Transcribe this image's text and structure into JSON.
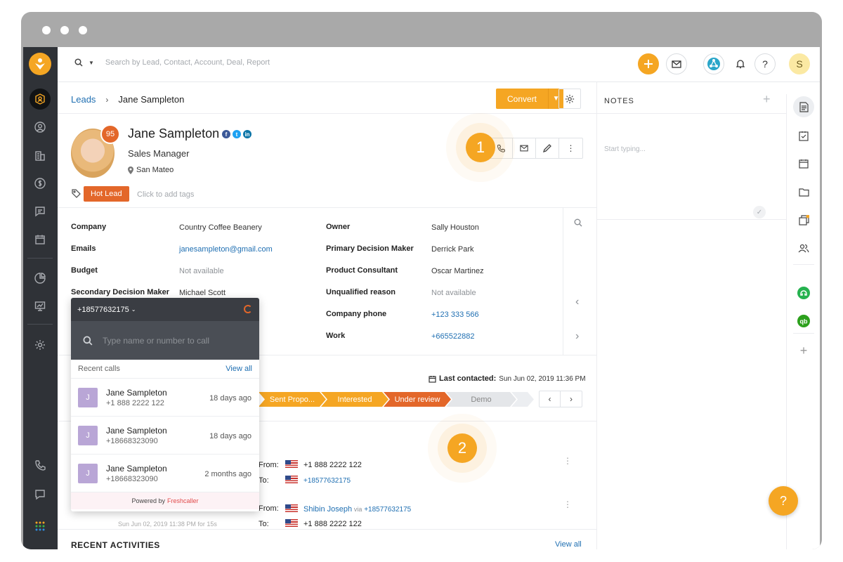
{
  "search": {
    "placeholder": "Search by Lead, Contact, Account, Deal, Report"
  },
  "topbar": {
    "avatar_initial": "S"
  },
  "breadcrumb": {
    "root": "Leads",
    "current": "Jane Sampleton"
  },
  "actions": {
    "convert_label": "Convert"
  },
  "lead": {
    "name": "Jane Sampleton",
    "score": "95",
    "title": "Sales Manager",
    "location": "San Mateo",
    "tag": "Hot Lead",
    "add_tags_placeholder": "Click to add tags"
  },
  "tour": {
    "step1": "1",
    "step2": "2"
  },
  "fields_left": [
    {
      "label": "Company",
      "value": "Country Coffee Beanery"
    },
    {
      "label": "Emails",
      "value": "janesampleton@gmail.com"
    },
    {
      "label": "Budget",
      "value": "Not available"
    },
    {
      "label": "Secondary Decision Maker",
      "value": "Michael Scott"
    }
  ],
  "fields_right": [
    {
      "label": "Owner",
      "value": "Sally Houston"
    },
    {
      "label": "Primary Decision Maker",
      "value": "Derrick Park"
    },
    {
      "label": "Product Consultant",
      "value": "Oscar Martinez"
    },
    {
      "label": "Unqualified reason",
      "value": "Not available"
    },
    {
      "label": "Company phone",
      "value": "+123 333 566"
    },
    {
      "label": "Work",
      "value": "+665522882"
    }
  ],
  "last_contacted": {
    "label": "Last contacted:",
    "value": "Sun Jun 02, 2019 11:36 PM"
  },
  "pipeline": {
    "stages": [
      {
        "label": "Sent Propo...",
        "color": "#f5a623"
      },
      {
        "label": "Interested",
        "color": "#f5a623"
      },
      {
        "label": "Under review",
        "color": "#e3672a"
      },
      {
        "label": "Demo",
        "color": "#e4e6e9"
      }
    ]
  },
  "calls": [
    {
      "from_label": "From:",
      "from": "+1 888 2222 122",
      "to_label": "To:",
      "to": "+18577632175"
    },
    {
      "from_label": "From:",
      "from": "Shibin Joseph",
      "via": "via",
      "via_number": "+18577632175",
      "to_label": "To:",
      "to": "+1 888 2222 122"
    }
  ],
  "call_meta": "Sun Jun 02, 2019 11:38 PM for 15s",
  "recent_activities": {
    "title": "RECENT ACTIVITIES",
    "view_all": "View all"
  },
  "dialer": {
    "number": "+18577632175",
    "search_placeholder": "Type name or number to call",
    "recent_label": "Recent calls",
    "view_all": "View all",
    "items": [
      {
        "initial": "J",
        "name": "Jane Sampleton",
        "phone": "+1 888 2222 122",
        "ago": "18 days ago"
      },
      {
        "initial": "J",
        "name": "Jane Sampleton",
        "phone": "+18668323090",
        "ago": "18 days ago"
      },
      {
        "initial": "J",
        "name": "Jane Sampleton",
        "phone": "+18668323090",
        "ago": "2 months ago"
      }
    ],
    "powered_by": "Powered by",
    "brand": "Freshcaller"
  },
  "notes": {
    "title": "NOTES",
    "placeholder": "Start typing..."
  },
  "colors": {
    "accent": "#f5a623",
    "hot": "#e3672a",
    "link": "#1f6fb2",
    "nav": "#2f3237"
  }
}
